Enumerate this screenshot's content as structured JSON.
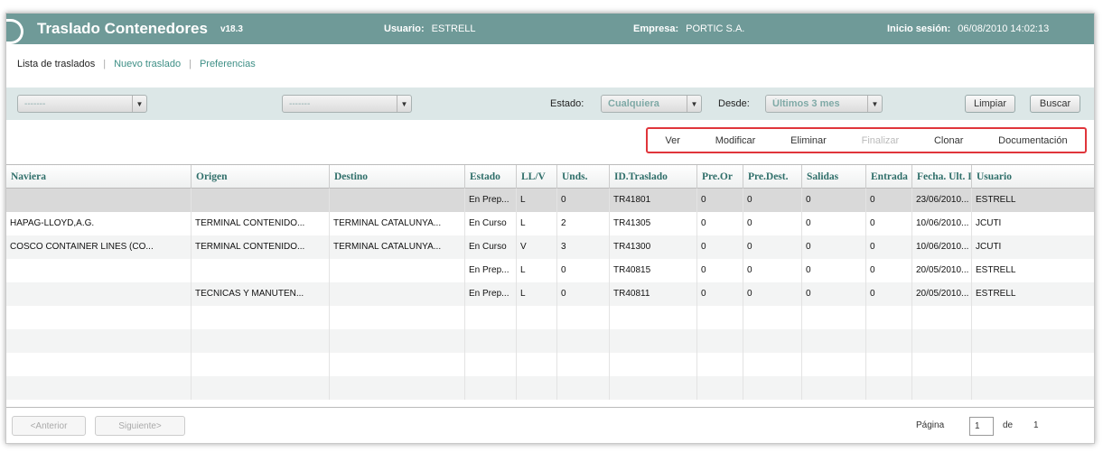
{
  "header": {
    "title": "Traslado Contenedores",
    "version": "v18.3",
    "user_label": "Usuario:",
    "user_value": "ESTRELL",
    "company_label": "Empresa:",
    "company_value": "PORTIC S.A.",
    "session_label": "Inicio sesión:",
    "session_value": "06/08/2010 14:02:13"
  },
  "tabs": [
    {
      "label": "Lista de traslados",
      "active": true
    },
    {
      "label": "Nuevo traslado",
      "active": false
    },
    {
      "label": "Preferencias",
      "active": false
    }
  ],
  "filters": {
    "select1_value": "-------",
    "select2_value": "-------",
    "estado_label": "Estado:",
    "estado_value": "Cualquiera",
    "desde_label": "Desde:",
    "desde_value": "Últimos 3 mes",
    "clear_label": "Limpiar",
    "search_label": "Buscar"
  },
  "actions": {
    "view": "Ver",
    "modify": "Modificar",
    "delete": "Eliminar",
    "finish": "Finalizar",
    "clone": "Clonar",
    "docs": "Documentación"
  },
  "table": {
    "columns": [
      "Naviera",
      "Origen",
      "Destino",
      "Estado",
      "LL/V",
      "Unds.",
      "ID.Traslado",
      "Pre.Or",
      "Pre.Dest.",
      "Salidas",
      "Entrada",
      "Fecha. Ult. I",
      "Usuario"
    ],
    "rows": [
      [
        "",
        "",
        "",
        "En Prep...",
        "L",
        "0",
        "TR41801",
        "0",
        "0",
        "0",
        "0",
        "23/06/2010...",
        "ESTRELL"
      ],
      [
        "HAPAG-LLOYD,A.G.",
        "TERMINAL CONTENIDO...",
        "TERMINAL CATALUNYA...",
        "En Curso",
        "L",
        "2",
        "TR41305",
        "0",
        "0",
        "0",
        "0",
        "10/06/2010...",
        "JCUTI"
      ],
      [
        "COSCO CONTAINER LINES (CO...",
        "TERMINAL CONTENIDO...",
        "TERMINAL CATALUNYA...",
        "En Curso",
        "V",
        "3",
        "TR41300",
        "0",
        "0",
        "0",
        "0",
        "10/06/2010...",
        "JCUTI"
      ],
      [
        "",
        "",
        "",
        "En Prep...",
        "L",
        "0",
        "TR40815",
        "0",
        "0",
        "0",
        "0",
        "20/05/2010...",
        "ESTRELL"
      ],
      [
        "",
        "TECNICAS Y MANUTEN...",
        "",
        "En Prep...",
        "L",
        "0",
        "TR40811",
        "0",
        "0",
        "0",
        "0",
        "20/05/2010...",
        "ESTRELL"
      ]
    ]
  },
  "pagination": {
    "prev_label": "<Anterior",
    "next_label": "Siguiente>",
    "page_label": "Página",
    "page_value": "1",
    "of_label": "de",
    "total_pages": "1"
  },
  "colors": {
    "header_bg": "#6f9a98",
    "accent": "#3e8f86",
    "highlight_border": "#e0353b"
  }
}
